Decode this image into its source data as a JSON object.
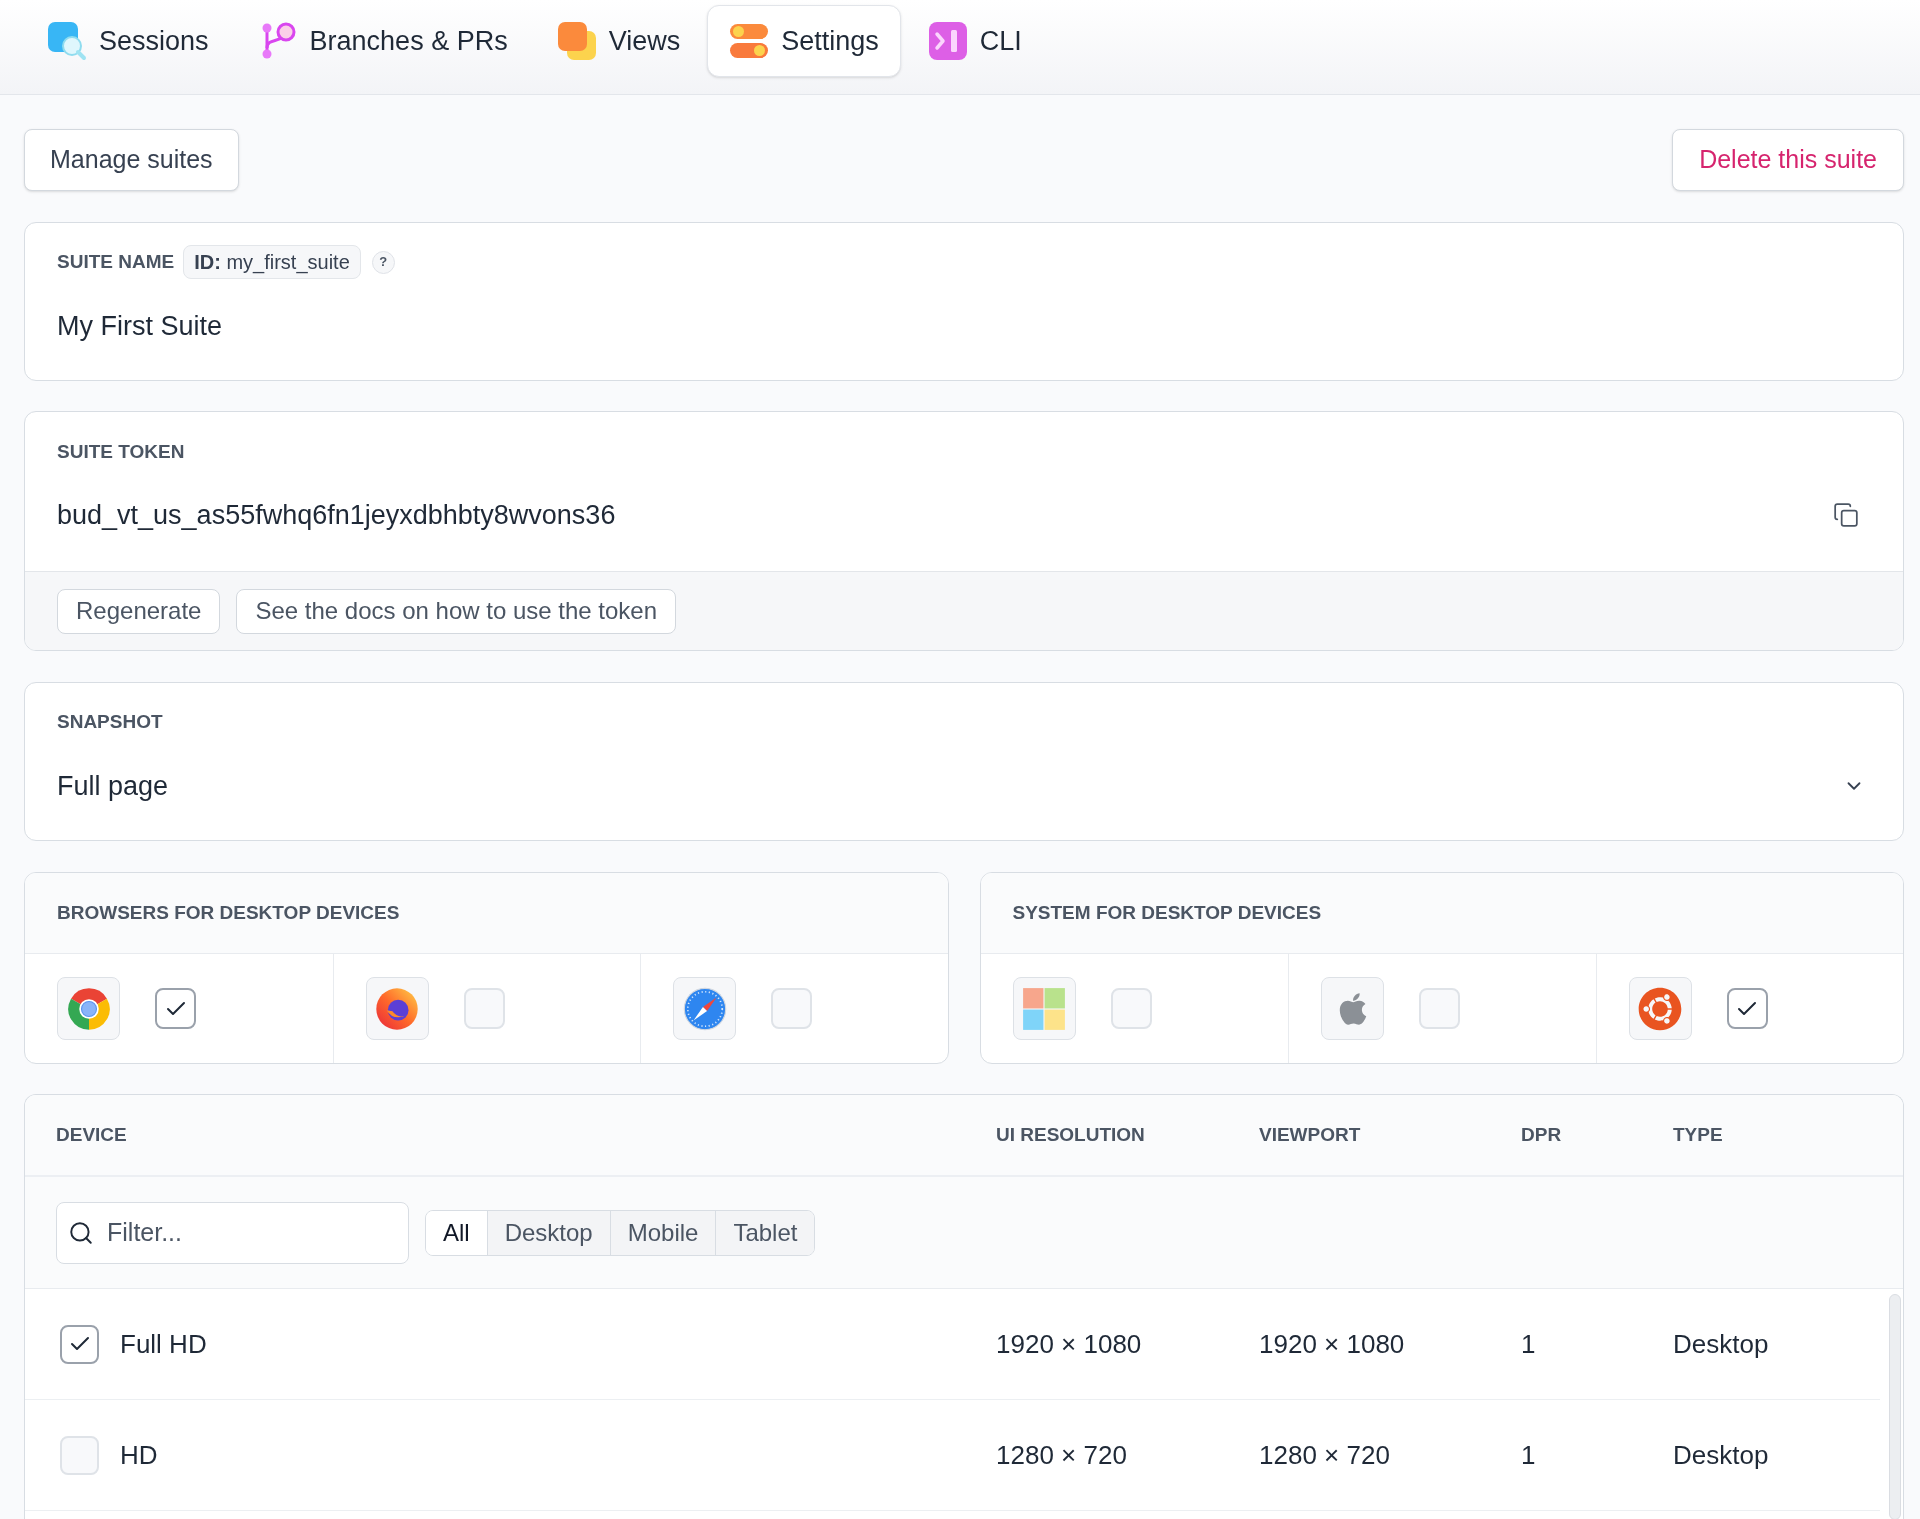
{
  "tabs": [
    {
      "label": "Sessions",
      "kind": "sessions",
      "selected": false
    },
    {
      "label": "Branches & PRs",
      "kind": "branches",
      "selected": false
    },
    {
      "label": "Views",
      "kind": "views",
      "selected": false
    },
    {
      "label": "Settings",
      "kind": "settings",
      "selected": true
    },
    {
      "label": "CLI",
      "kind": "cli",
      "selected": false
    }
  ],
  "toolbar": {
    "manage_button": "Manage suites",
    "delete_button": "Delete this suite"
  },
  "suite_name": {
    "label": "SUITE NAME",
    "id_badge": "**ID:** my_first_suite",
    "help": "?",
    "value": "My First Suite"
  },
  "suite_token": {
    "label": "SUITE TOKEN",
    "value": "bud_vt_us_as55fwhq6fn1jeyxdbhbty8wvons36",
    "buttons": [
      "Regenerate",
      "See the docs on how to use the token"
    ]
  },
  "snapshot": {
    "label": "SNAPSHOT",
    "value": "Full page"
  },
  "browsers": {
    "title": "BROWSERS FOR DESKTOP DEVICES",
    "items": [
      {
        "kind": "chrome",
        "checked": true
      },
      {
        "kind": "firefox",
        "checked": false
      },
      {
        "kind": "safari",
        "checked": false
      }
    ]
  },
  "systems": {
    "title": "SYSTEM FOR DESKTOP DEVICES",
    "items": [
      {
        "kind": "windows",
        "checked": false
      },
      {
        "kind": "apple",
        "checked": false
      },
      {
        "kind": "ubuntu",
        "checked": true
      }
    ]
  },
  "devices": {
    "columns": [
      "DEVICE",
      "UI RESOLUTION",
      "VIEWPORT",
      "DPR",
      "TYPE"
    ],
    "filter": {
      "placeholder": "Filter..."
    },
    "type_filters": [
      {
        "label": "All",
        "selected": true
      },
      {
        "label": "Desktop",
        "selected": false
      },
      {
        "label": "Mobile",
        "selected": false
      },
      {
        "label": "Tablet",
        "selected": false
      }
    ],
    "rows": [
      {
        "checked": true,
        "name": "Full HD",
        "ui_resolution": "1920 × 1080",
        "viewport": "1920 × 1080",
        "dpr": "1",
        "type": "Desktop"
      },
      {
        "checked": false,
        "name": "HD",
        "ui_resolution": "1280 × 720",
        "viewport": "1280 × 720",
        "dpr": "1",
        "type": "Desktop"
      }
    ]
  }
}
